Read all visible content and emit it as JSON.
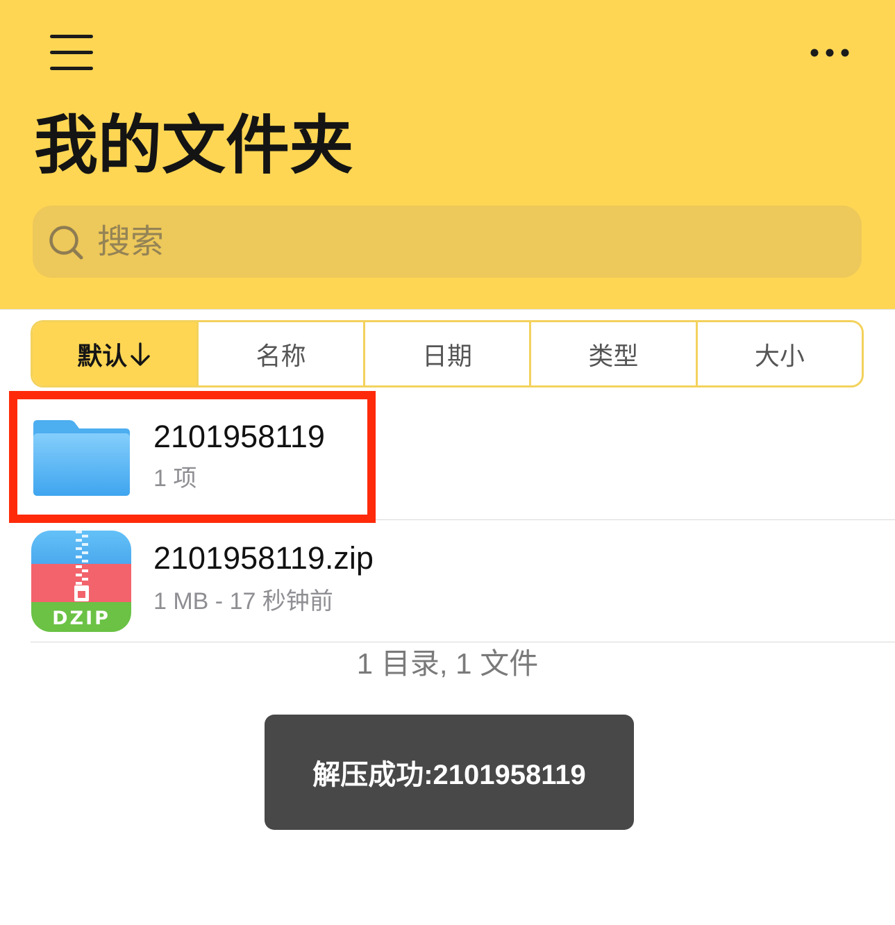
{
  "header": {
    "menu_icon": "hamburger-menu-icon",
    "more_icon": "more-horizontal-icon",
    "title": "我的文件夹"
  },
  "search": {
    "icon": "search-icon",
    "placeholder": "搜索"
  },
  "sort_tabs": [
    {
      "label": "默认",
      "icon": "arrow-down-icon",
      "selected": true
    },
    {
      "label": "名称",
      "selected": false
    },
    {
      "label": "日期",
      "selected": false
    },
    {
      "label": "类型",
      "selected": false
    },
    {
      "label": "大小",
      "selected": false
    }
  ],
  "files": [
    {
      "name": "2101958119",
      "detail": "1 项",
      "icon": "folder-icon",
      "highlighted": true
    },
    {
      "name": "2101958119.zip",
      "detail": "1 MB - 17 秒钟前",
      "icon": "zip-archive-icon",
      "icon_label": "DZIP",
      "highlighted": false
    }
  ],
  "summary": "1 目录, 1 文件",
  "toast": {
    "message": "解压成功:2101958119"
  },
  "colors": {
    "header_background": "#FED653",
    "search_background": "#EDC85A",
    "tab_border": "#F3D25D",
    "tab_selected_background": "#FED653",
    "highlight_border": "#FF2A0A",
    "toast_background": "#484848",
    "folder": "#4DAEF0"
  }
}
